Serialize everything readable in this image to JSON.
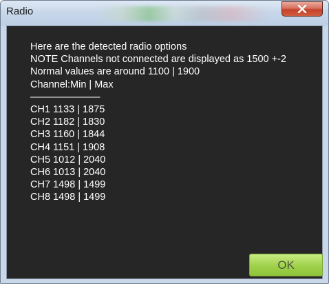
{
  "window": {
    "title": "Radio"
  },
  "colors": {
    "client_background": "#262626",
    "text": "#ffffff",
    "ok_button": "#a6d654",
    "close_button": "#c9482f"
  },
  "message": {
    "lines": [
      "Here are the detected radio options",
      "NOTE Channels not connected are displayed as 1500 +-2",
      "Normal values are around 1100 | 1900",
      "Channel:Min | Max",
      "———————",
      "CH1 1133 | 1875",
      "CH2 1182 | 1830",
      "CH3 1160 | 1844",
      "CH4 1151 | 1908",
      "CH5 1012 | 2040",
      "CH6 1013 | 2040",
      "CH7 1498 | 1499",
      "CH8 1498 | 1499"
    ]
  },
  "buttons": {
    "ok_label": "OK",
    "close_icon": "close-x-icon"
  }
}
